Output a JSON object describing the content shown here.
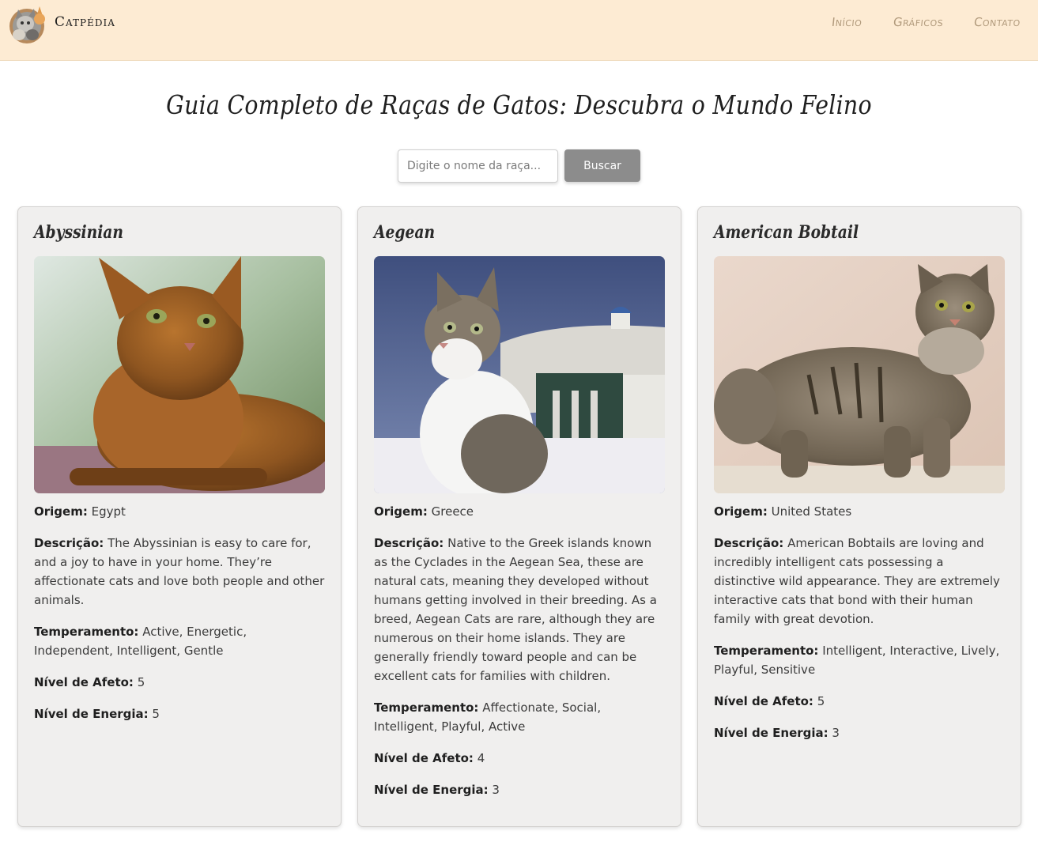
{
  "header": {
    "brand": "Catpédia",
    "nav": [
      "Início",
      "Gráficos",
      "Contato"
    ]
  },
  "hero": {
    "title": "Guia Completo de Raças de Gatos: Descubra o Mundo Felino",
    "search_placeholder": "Digite o nome da raça...",
    "search_button": "Buscar"
  },
  "labels": {
    "origin": "Origem:",
    "description": "Descrição:",
    "temperament": "Temperamento:",
    "affection": "Nível de Afeto:",
    "energy": "Nível de Energia:"
  },
  "breeds": [
    {
      "name": "Abyssinian",
      "origin": "Egypt",
      "description": "The Abyssinian is easy to care for, and a joy to have in your home. They’re affectionate cats and love both people and other animals.",
      "temperament": "Active, Energetic, Independent, Intelligent, Gentle",
      "affection_level": "5",
      "energy_level": "5"
    },
    {
      "name": "Aegean",
      "origin": "Greece",
      "description": "Native to the Greek islands known as the Cyclades in the Aegean Sea, these are natural cats, meaning they developed without humans getting involved in their breeding. As a breed, Aegean Cats are rare, although they are numerous on their home islands. They are generally friendly toward people and can be excellent cats for families with children.",
      "temperament": "Affectionate, Social, Intelligent, Playful, Active",
      "affection_level": "4",
      "energy_level": "3"
    },
    {
      "name": "American Bobtail",
      "origin": "United States",
      "description": "American Bobtails are loving and incredibly intelligent cats possessing a distinctive wild appearance. They are extremely interactive cats that bond with their human family with great devotion.",
      "temperament": "Intelligent, Interactive, Lively, Playful, Sensitive",
      "affection_level": "5",
      "energy_level": "3"
    }
  ],
  "colors": {
    "header_bg": "#fdebd3",
    "nav_link": "#b19a7c",
    "card_bg": "#f0efee",
    "button_bg": "#8c8c8c"
  }
}
